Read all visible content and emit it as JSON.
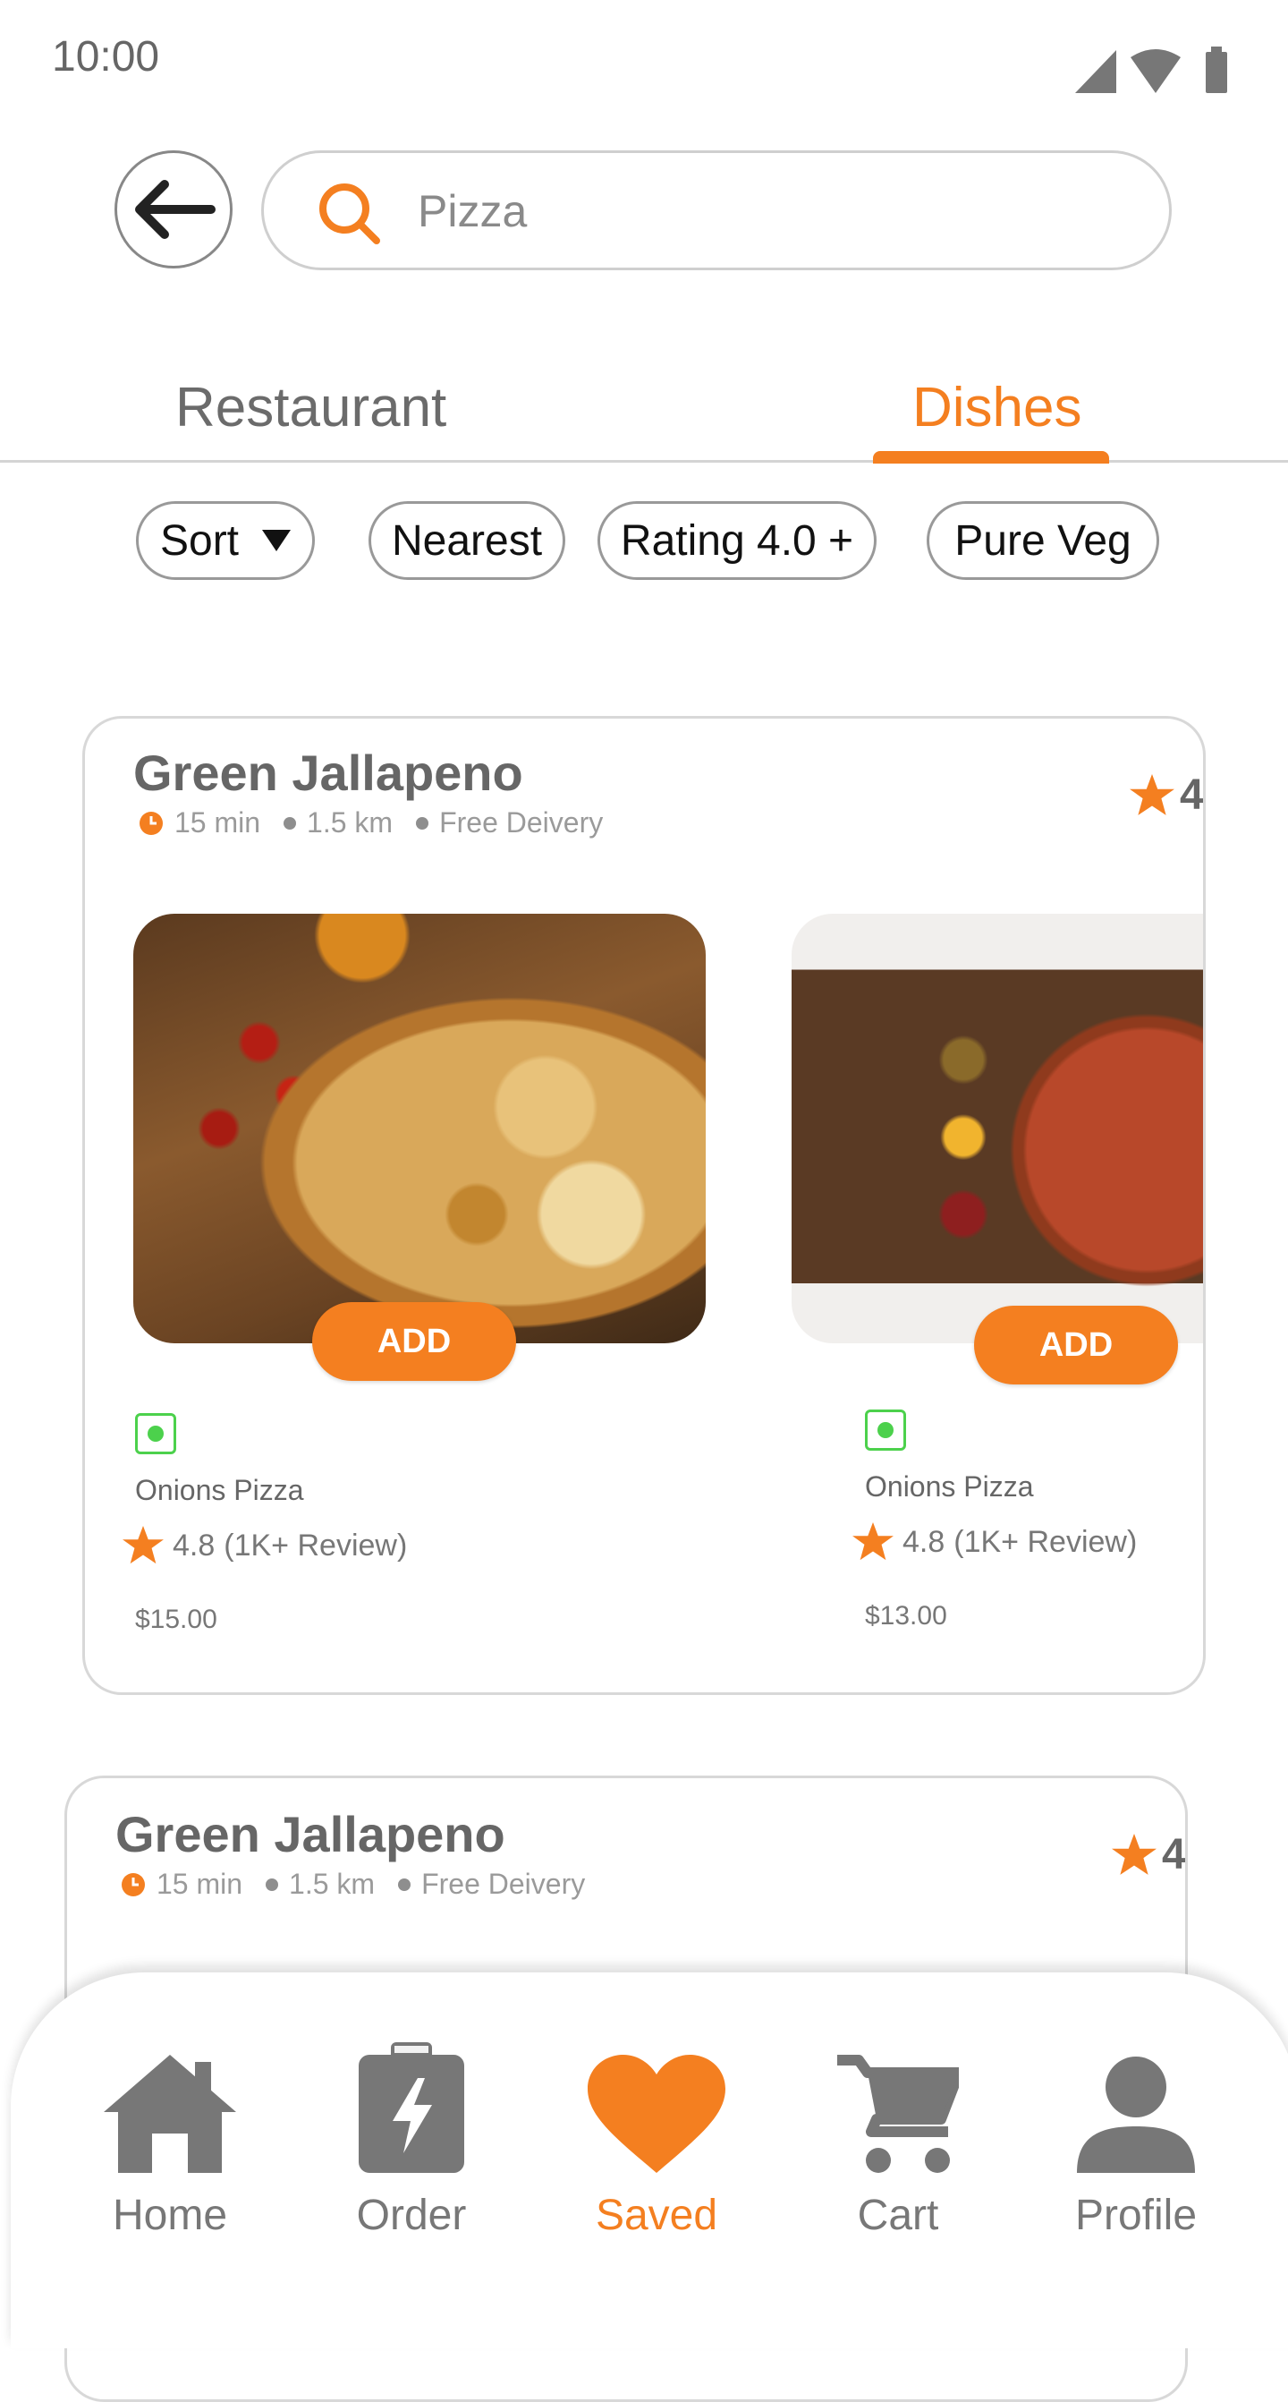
{
  "status_bar": {
    "time": "10:00"
  },
  "search": {
    "value": "",
    "placeholder": "Pizza"
  },
  "tabs": [
    {
      "label": "Restaurant",
      "active": false
    },
    {
      "label": "Dishes",
      "active": true
    }
  ],
  "filters": {
    "sort": "Sort",
    "nearest": "Nearest",
    "rating": "Rating 4.0 +",
    "veg": "Pure Veg"
  },
  "colors": {
    "accent": "#F47F20",
    "veg_green": "#4CD14C",
    "nav_inactive": "#777777"
  },
  "restaurants": [
    {
      "name": "Green Jallapeno",
      "time": "15 min",
      "distance": "1.5 km",
      "delivery": "Free Deivery",
      "rating": "4",
      "dishes": [
        {
          "name": "Onions Pizza",
          "rating": "4.8",
          "reviews": "(1K+ Review)",
          "price": "$15.00",
          "add_label": "ADD"
        },
        {
          "name": "Onions Pizza",
          "rating": "4.8",
          "reviews": "(1K+ Review)",
          "price": "$13.00",
          "add_label": "ADD"
        }
      ]
    },
    {
      "name": "Green Jallapeno",
      "time": "15 min",
      "distance": "1.5 km",
      "delivery": "Free Deivery",
      "rating": "4"
    }
  ],
  "bottom_nav": [
    {
      "label": "Home",
      "icon": "home-icon",
      "active": false
    },
    {
      "label": "Order",
      "icon": "order-icon",
      "active": false
    },
    {
      "label": "Saved",
      "icon": "heart-icon",
      "active": true
    },
    {
      "label": "Cart",
      "icon": "cart-icon",
      "active": false
    },
    {
      "label": "Profile",
      "icon": "profile-icon",
      "active": false
    }
  ]
}
